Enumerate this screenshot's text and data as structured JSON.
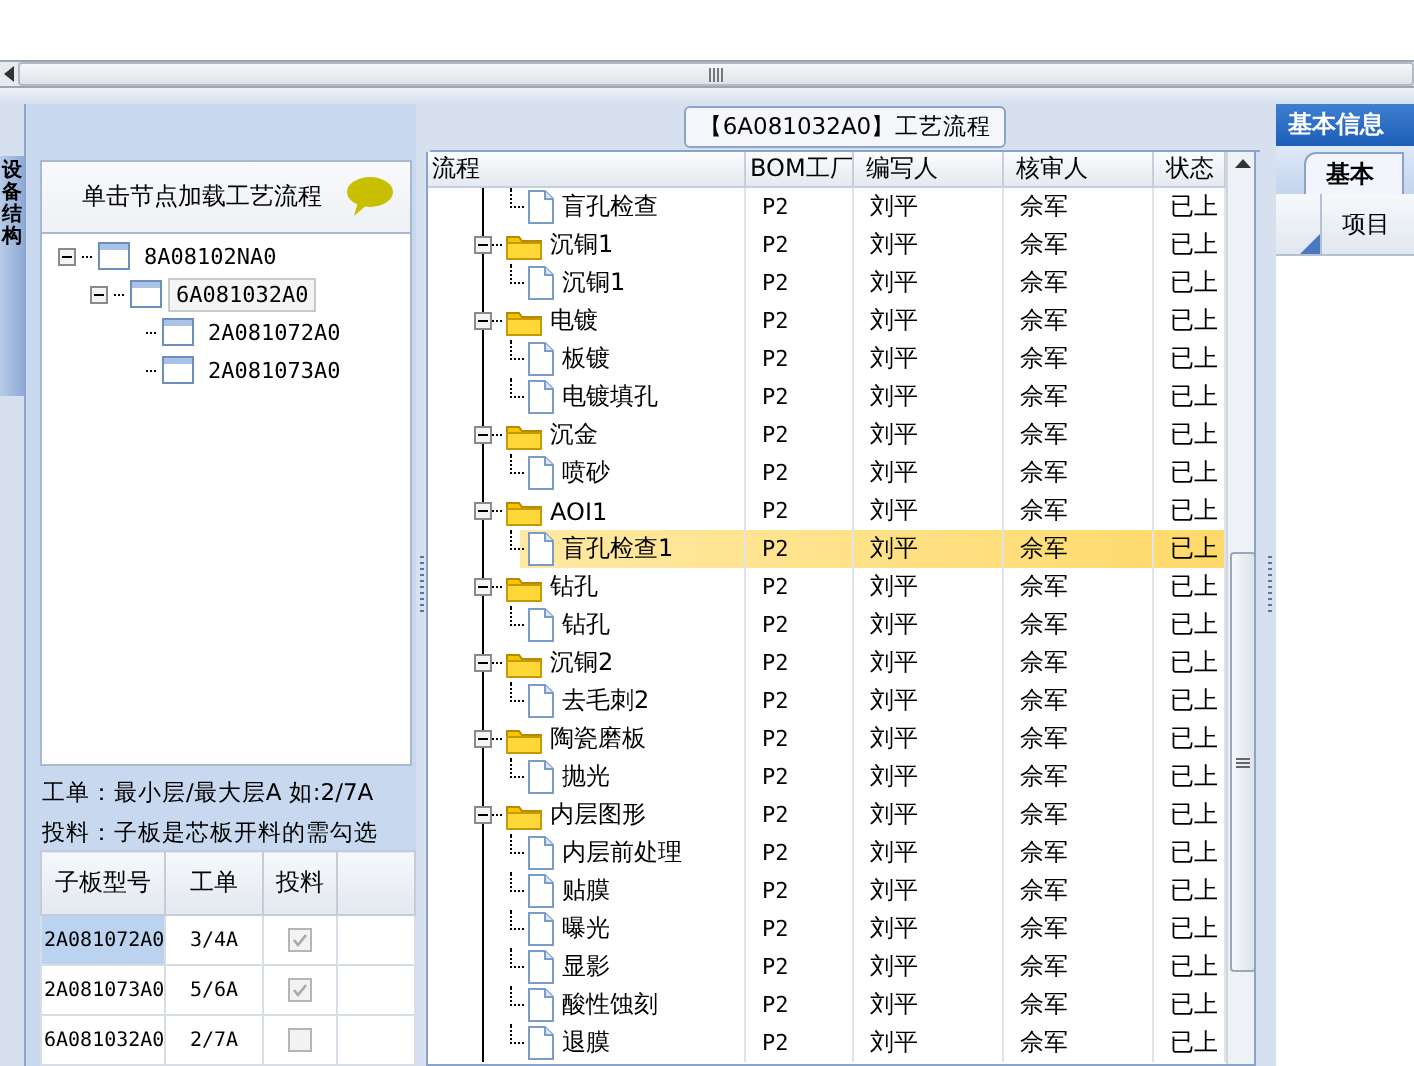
{
  "side_tab": {
    "label": "设备结构"
  },
  "structure_panel": {
    "title": "单击节点加载工艺流程",
    "tree": [
      {
        "label": "8A08102NA0",
        "expanded": true,
        "selected": false,
        "children": [
          {
            "label": "6A081032A0",
            "expanded": true,
            "selected": true,
            "children": [
              {
                "label": "2A081072A0",
                "selected": false
              },
              {
                "label": "2A081073A0",
                "selected": false
              }
            ]
          }
        ]
      }
    ],
    "hints": [
      "工单：最小层/最大层A 如:2/7A",
      "投料：子板是芯板开料的需勾选"
    ],
    "table": {
      "columns": [
        "子板型号",
        "工单",
        "投料"
      ],
      "rows": [
        {
          "model": "2A081072A0",
          "order": "3/4A",
          "feed": true,
          "selected": true
        },
        {
          "model": "2A081073A0",
          "order": "5/6A",
          "feed": true,
          "selected": false
        },
        {
          "model": "6A081032A0",
          "order": "2/7A",
          "feed": false,
          "selected": false
        }
      ]
    }
  },
  "process_panel": {
    "title": "【6A081032A0】工艺流程",
    "columns": [
      "流程",
      "BOM工厂",
      "编写人",
      "核审人",
      "状态"
    ],
    "rows": [
      {
        "kind": "step",
        "label": "盲孔检查",
        "bom": "P2",
        "writer": "刘平",
        "reviewer": "佘军",
        "status": "已上",
        "selected": false
      },
      {
        "kind": "group",
        "label": "沉铜1",
        "expanded": true,
        "bom": "P2",
        "writer": "刘平",
        "reviewer": "佘军",
        "status": "已上",
        "selected": false,
        "children": [
          {
            "kind": "step",
            "label": "沉铜1",
            "bom": "P2",
            "writer": "刘平",
            "reviewer": "佘军",
            "status": "已上",
            "selected": false
          }
        ]
      },
      {
        "kind": "group",
        "label": "电镀",
        "expanded": true,
        "bom": "P2",
        "writer": "刘平",
        "reviewer": "佘军",
        "status": "已上",
        "selected": false,
        "children": [
          {
            "kind": "step",
            "label": "板镀",
            "bom": "P2",
            "writer": "刘平",
            "reviewer": "佘军",
            "status": "已上",
            "selected": false
          },
          {
            "kind": "step",
            "label": "电镀填孔",
            "bom": "P2",
            "writer": "刘平",
            "reviewer": "佘军",
            "status": "已上",
            "selected": false
          }
        ]
      },
      {
        "kind": "group",
        "label": "沉金",
        "expanded": true,
        "bom": "P2",
        "writer": "刘平",
        "reviewer": "佘军",
        "status": "已上",
        "selected": false,
        "children": [
          {
            "kind": "step",
            "label": "喷砂",
            "bom": "P2",
            "writer": "刘平",
            "reviewer": "佘军",
            "status": "已上",
            "selected": false
          }
        ]
      },
      {
        "kind": "group",
        "label": "AOI1",
        "expanded": true,
        "bom": "P2",
        "writer": "刘平",
        "reviewer": "佘军",
        "status": "已上",
        "selected": false,
        "children": [
          {
            "kind": "step",
            "label": "盲孔检查1",
            "bom": "P2",
            "writer": "刘平",
            "reviewer": "佘军",
            "status": "已上",
            "selected": true
          }
        ]
      },
      {
        "kind": "group",
        "label": "钻孔",
        "expanded": true,
        "bom": "P2",
        "writer": "刘平",
        "reviewer": "佘军",
        "status": "已上",
        "selected": false,
        "children": [
          {
            "kind": "step",
            "label": "钻孔",
            "bom": "P2",
            "writer": "刘平",
            "reviewer": "佘军",
            "status": "已上",
            "selected": false
          }
        ]
      },
      {
        "kind": "group",
        "label": "沉铜2",
        "expanded": true,
        "bom": "P2",
        "writer": "刘平",
        "reviewer": "佘军",
        "status": "已上",
        "selected": false,
        "children": [
          {
            "kind": "step",
            "label": "去毛刺2",
            "bom": "P2",
            "writer": "刘平",
            "reviewer": "佘军",
            "status": "已上",
            "selected": false
          }
        ]
      },
      {
        "kind": "group",
        "label": "陶瓷磨板",
        "expanded": true,
        "bom": "P2",
        "writer": "刘平",
        "reviewer": "佘军",
        "status": "已上",
        "selected": false,
        "children": [
          {
            "kind": "step",
            "label": "抛光",
            "bom": "P2",
            "writer": "刘平",
            "reviewer": "佘军",
            "status": "已上",
            "selected": false
          }
        ]
      },
      {
        "kind": "group",
        "label": "内层图形",
        "expanded": true,
        "bom": "P2",
        "writer": "刘平",
        "reviewer": "佘军",
        "status": "已上",
        "selected": false,
        "children": [
          {
            "kind": "step",
            "label": "内层前处理",
            "bom": "P2",
            "writer": "刘平",
            "reviewer": "佘军",
            "status": "已上",
            "selected": false
          },
          {
            "kind": "step",
            "label": "贴膜",
            "bom": "P2",
            "writer": "刘平",
            "reviewer": "佘军",
            "status": "已上",
            "selected": false
          },
          {
            "kind": "step",
            "label": "曝光",
            "bom": "P2",
            "writer": "刘平",
            "reviewer": "佘军",
            "status": "已上",
            "selected": false
          },
          {
            "kind": "step",
            "label": "显影",
            "bom": "P2",
            "writer": "刘平",
            "reviewer": "佘军",
            "status": "已上",
            "selected": false
          },
          {
            "kind": "step",
            "label": "酸性蚀刻",
            "bom": "P2",
            "writer": "刘平",
            "reviewer": "佘军",
            "status": "已上",
            "selected": false
          },
          {
            "kind": "step",
            "label": "退膜",
            "bom": "P2",
            "writer": "刘平",
            "reviewer": "佘军",
            "status": "已上",
            "selected": false
          }
        ]
      }
    ]
  },
  "info_panel": {
    "title": "基本信息",
    "tab": "基本",
    "column": "项目"
  }
}
